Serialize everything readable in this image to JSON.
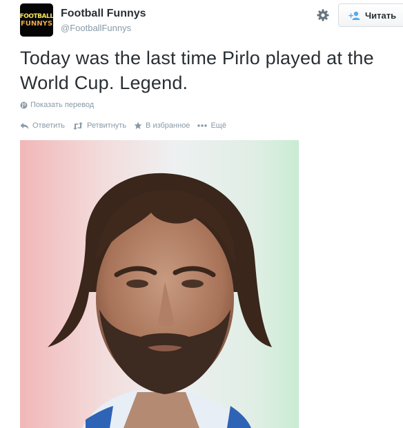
{
  "account": {
    "name": "Football Funnys",
    "handle": "@FootballFunnys",
    "avatar_line1": "FOOTBALL",
    "avatar_line2": "FUNNYS"
  },
  "follow_button": {
    "label": "Читать",
    "icon": "follow-user-icon"
  },
  "settings_icon": "gear-icon",
  "tweet": {
    "text": "Today was the last time Pirlo played at the World Cup. Legend.",
    "translate_label": "Показать перевод"
  },
  "actions": [
    {
      "label": "Ответить",
      "icon": "reply-icon"
    },
    {
      "label": "Ретвитнуть",
      "icon": "retweet-icon"
    },
    {
      "label": "В избранное",
      "icon": "star-icon"
    },
    {
      "label": "Ещё",
      "icon": "more-icon"
    }
  ],
  "colors": {
    "text": "#292f33",
    "muted": "#8899a6",
    "follow_icon": "#55acee"
  }
}
